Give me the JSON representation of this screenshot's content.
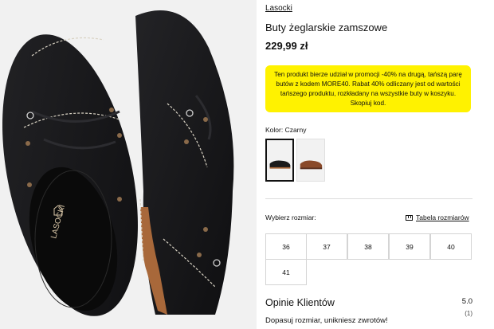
{
  "product": {
    "brand": "Lasocki",
    "title": "Buty żeglarskie zamszowe",
    "price": "229,99 zł",
    "insole_logo": "LASOCKI"
  },
  "promo": {
    "text": "Ten produkt bierze udział w promocji -40% na drugą, tańszą parę butów z kodem MORE40. Rabat 40% odliczany jest od wartości tańszego produktu, rozkładany na wszystkie buty w koszyku. Skopiuj kod.",
    "background": "#fff200"
  },
  "color": {
    "label": "Kolor: Czarny",
    "options": [
      {
        "name": "Czarny",
        "swatch": "#1b1b1b",
        "selected": true
      },
      {
        "name": "Brązowy",
        "swatch": "#8a4a2a",
        "selected": false
      }
    ]
  },
  "sizes": {
    "label": "Wybierz rozmiar:",
    "chart_link": "Tabela rozmiarów",
    "options": [
      "36",
      "37",
      "38",
      "39",
      "40",
      "41"
    ]
  },
  "reviews": {
    "title": "Opinie Klientów",
    "score": "5.0",
    "count": "(1)",
    "subtitle": "Dopasuj rozmiar, unikniesz zwrotów!"
  },
  "colors": {
    "suede": "#17171a",
    "sole": "#a8683a",
    "stitch": "#d9d3c4"
  },
  "icons": [
    "ruler-icon"
  ]
}
